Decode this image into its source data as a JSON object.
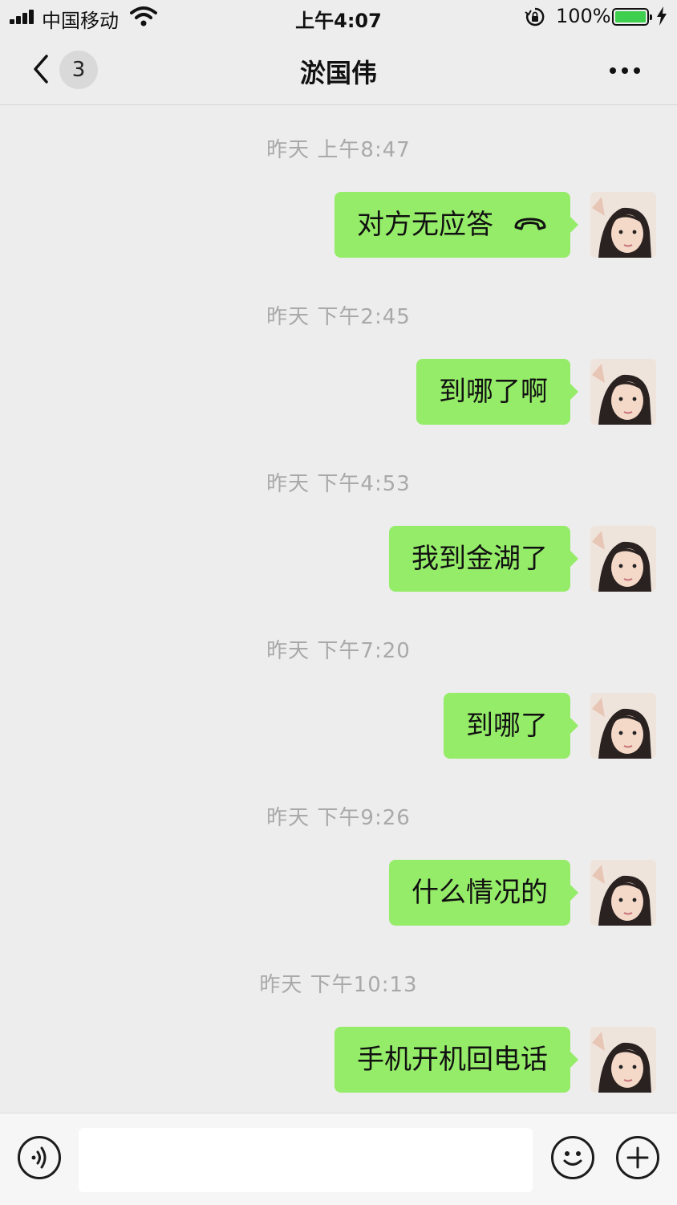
{
  "status_bar": {
    "carrier": "中国移动",
    "time": "上午4:07",
    "battery": "100%",
    "battery_level": 1.0
  },
  "nav": {
    "unread_count": "3",
    "title": "淤国伟"
  },
  "messages": [
    {
      "timestamp": "昨天 上午8:47",
      "text": "对方无应答",
      "has_call_icon": true
    },
    {
      "timestamp": "昨天 下午2:45",
      "text": "到哪了啊"
    },
    {
      "timestamp": "昨天 下午4:53",
      "text": "我到金湖了"
    },
    {
      "timestamp": "昨天 下午7:20",
      "text": "到哪了"
    },
    {
      "timestamp": "昨天 下午9:26",
      "text": "什么情况的"
    },
    {
      "timestamp": "昨天 下午10:13",
      "text": "手机开机回电话"
    }
  ],
  "input": {
    "value": "",
    "placeholder": ""
  },
  "icons": {
    "back": "chevron-left-icon",
    "more": "ellipsis-icon",
    "voice": "voice-icon",
    "emoji": "emoji-icon",
    "plus": "plus-icon",
    "call": "phone-hangup-icon"
  },
  "colors": {
    "background": "#ededed",
    "bubble_green": "#95ec69",
    "timestamp_gray": "#a9a9a9",
    "battery_green": "#3ecf4f"
  }
}
